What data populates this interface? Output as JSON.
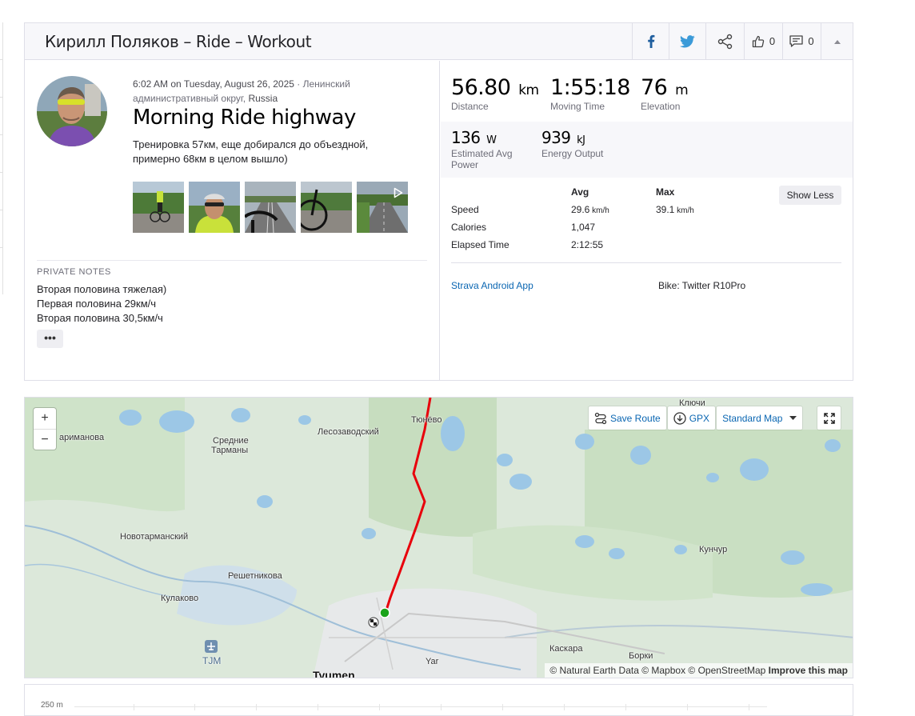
{
  "header": {
    "title": "Кирилл Поляков – Ride – Workout",
    "kudos_count": "0",
    "comments_count": "0"
  },
  "activity": {
    "time": "6:02 AM on",
    "date": "Tuesday, August 26, 2025",
    "location_prefix": " · Ленинский административный округ, ",
    "location_country": "Russia",
    "title": "Morning Ride highway",
    "description": "Тренировка 57км, еще добирался до объездной, примерно 68км в целом вышло)"
  },
  "notes": {
    "label": "PRIVATE NOTES",
    "lines": [
      "Вторая половина тяжелая)",
      "Первая половина 29км/ч",
      "Вторая половина 30,5км/ч"
    ],
    "more": "•••"
  },
  "stats": {
    "distance": {
      "value": "56.80",
      "unit": "km",
      "label": "Distance"
    },
    "moving_time": {
      "value": "1:55:18",
      "label": "Moving Time"
    },
    "elevation": {
      "value": "76",
      "unit": "m",
      "label": "Elevation"
    },
    "power": {
      "value": "136",
      "unit": "W",
      "label": "Estimated Avg Power"
    },
    "energy": {
      "value": "939",
      "unit": "kJ",
      "label": "Energy Output"
    }
  },
  "table": {
    "col_avg": "Avg",
    "col_max": "Max",
    "rows": [
      {
        "label": "Speed",
        "avg": "29.6",
        "avg_unit": " km/h",
        "max": "39.1",
        "max_unit": " km/h"
      },
      {
        "label": "Calories",
        "avg": "1,047"
      },
      {
        "label": "Elapsed Time",
        "avg": "2:12:55"
      }
    ],
    "show_less": "Show Less"
  },
  "device": {
    "app": "Strava Android App",
    "bike": "Bike: Twitter R10Pro"
  },
  "map": {
    "zoom_in": "+",
    "zoom_out": "−",
    "save_route": "Save Route",
    "gpx": "GPX",
    "map_style": "Standard Map",
    "places": [
      "Ключи",
      "Тюнёво",
      "Лесозаводский",
      "ариманова",
      "Средние",
      "Тарманы",
      "Новотарманский",
      "Решетникова",
      "Кулаково",
      "Кунчур",
      "TJM",
      "Каскара",
      "Борки",
      "Yar",
      "Tyumen"
    ],
    "attribution": "© Natural Earth Data © Mapbox © OpenStreetMap",
    "improve": "Improve this map",
    "route_color": "#e8000b"
  },
  "elevation_chart": {
    "label": "250 m"
  }
}
